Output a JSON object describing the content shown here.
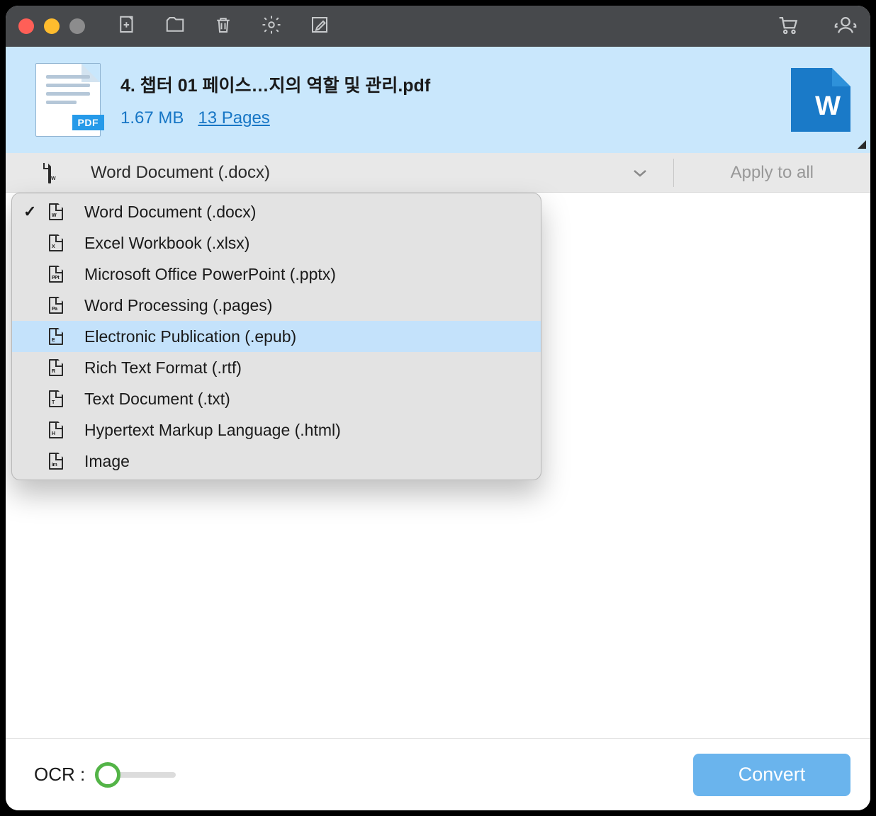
{
  "file": {
    "name": "4. 챕터 01 페이스…지의 역할 및 관리.pdf",
    "size": "1.67 MB",
    "pages": "13 Pages",
    "badge": "PDF",
    "target_letter": "W"
  },
  "format_bar": {
    "selected": "Word Document (.docx)",
    "apply_all": "Apply to all"
  },
  "dropdown": {
    "items": [
      {
        "label": "Word Document (.docx)",
        "tag": "W",
        "checked": true,
        "hover": false
      },
      {
        "label": "Excel Workbook (.xlsx)",
        "tag": "X",
        "checked": false,
        "hover": false
      },
      {
        "label": "Microsoft Office PowerPoint (.pptx)",
        "tag": "PPt",
        "checked": false,
        "hover": false
      },
      {
        "label": "Word Processing (.pages)",
        "tag": "Pa",
        "checked": false,
        "hover": false
      },
      {
        "label": "Electronic Publication (.epub)",
        "tag": "E",
        "checked": false,
        "hover": true
      },
      {
        "label": "Rich Text Format (.rtf)",
        "tag": "R",
        "checked": false,
        "hover": false
      },
      {
        "label": "Text Document (.txt)",
        "tag": "T",
        "checked": false,
        "hover": false
      },
      {
        "label": "Hypertext Markup Language (.html)",
        "tag": "H",
        "checked": false,
        "hover": false
      },
      {
        "label": "Image",
        "tag": "im",
        "checked": false,
        "hover": false
      }
    ]
  },
  "footer": {
    "ocr_label": "OCR :",
    "convert": "Convert"
  }
}
